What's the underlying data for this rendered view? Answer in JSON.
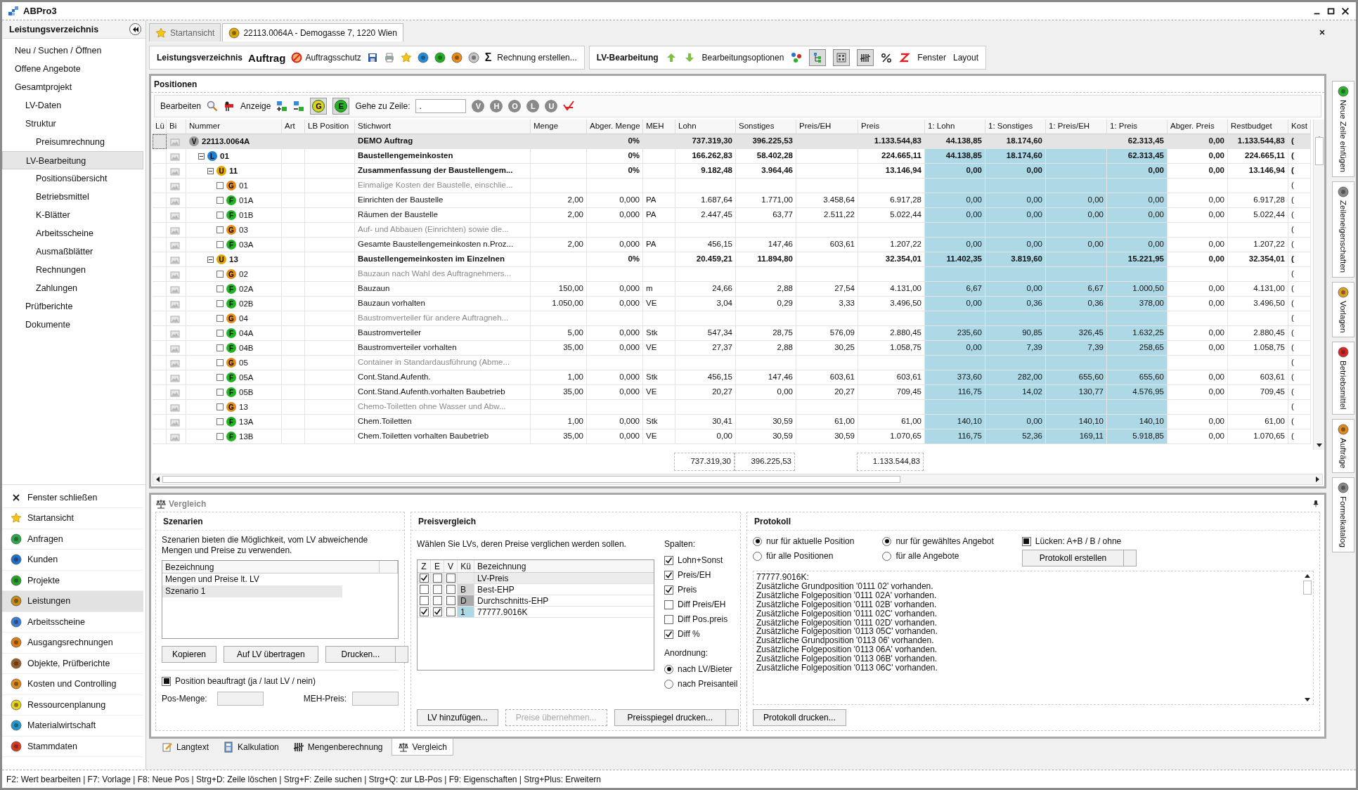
{
  "window": {
    "title": "ABPro3"
  },
  "sidebar": {
    "title": "Leistungsverzeichnis",
    "tree": [
      {
        "label": "Neu / Suchen / Öffnen",
        "selected": false
      },
      {
        "label": "Offene Angebote",
        "selected": false
      },
      {
        "label": "Gesamtprojekt",
        "selected": false,
        "children": [
          {
            "label": "LV-Daten",
            "selected": false
          },
          {
            "label": "Struktur",
            "selected": false,
            "children": [
              {
                "label": "Preisumrechnung",
                "selected": false
              }
            ]
          },
          {
            "label": "LV-Bearbeitung",
            "selected": true,
            "children": [
              {
                "label": "Positionsübersicht",
                "selected": false
              },
              {
                "label": "Betriebsmittel",
                "selected": false
              },
              {
                "label": "K-Blätter",
                "selected": false
              },
              {
                "label": "Arbeitsscheine",
                "selected": false
              },
              {
                "label": "Ausmaßblätter",
                "selected": false
              },
              {
                "label": "Rechnungen",
                "selected": false
              },
              {
                "label": "Zahlungen",
                "selected": false
              }
            ]
          },
          {
            "label": "Prüfberichte",
            "selected": false
          },
          {
            "label": "Dokumente",
            "selected": false
          }
        ]
      }
    ],
    "nav": [
      {
        "label": "Fenster schließen",
        "selected": false
      },
      {
        "label": "Startansicht",
        "selected": false
      },
      {
        "label": "Anfragen",
        "selected": false
      },
      {
        "label": "Kunden",
        "selected": false
      },
      {
        "label": "Projekte",
        "selected": false
      },
      {
        "label": "Leistungen",
        "selected": true
      },
      {
        "label": "Arbeitsscheine",
        "selected": false
      },
      {
        "label": "Ausgangsrechnungen",
        "selected": false
      },
      {
        "label": "Objekte, Prüfberichte",
        "selected": false
      },
      {
        "label": "Kosten und Controlling",
        "selected": false
      },
      {
        "label": "Ressourcenplanung",
        "selected": false
      },
      {
        "label": "Materialwirtschaft",
        "selected": false
      },
      {
        "label": "Stammdaten",
        "selected": false
      }
    ]
  },
  "tabs": [
    {
      "label": "Startansicht",
      "selected": false
    },
    {
      "label": "22113.0064A - Demogasse 7, 1220 Wien",
      "selected": true
    }
  ],
  "toolbar": {
    "lv_menu": "Leistungsverzeichnis",
    "auftrag_menu": "Auftrag",
    "protect_button": "Auftragsschutz",
    "sum_icon": "Σ",
    "invoice_button": "Rechnung erstellen...",
    "edit_menu": "LV-Bearbeitung",
    "options_menu": "Bearbeitungsoptionen",
    "toggles": [
      {
        "pressed": true
      },
      {
        "pressed": true
      },
      {
        "pressed": true
      }
    ],
    "window_menu": "Fenster",
    "layout_menu": "Layout"
  },
  "positions": {
    "title": "Positionen",
    "edit_menu": "Bearbeiten",
    "view_menu": "Anzeige",
    "filter_toggles": [
      {
        "label": "G",
        "pressed": true
      },
      {
        "label": "E",
        "pressed": true
      }
    ],
    "goto_label": "Gehe zu Zeile:",
    "goto_value": ".",
    "level_filters": [
      {
        "label": "V",
        "disabled": true
      },
      {
        "label": "H",
        "disabled": true
      },
      {
        "label": "O",
        "disabled": true
      },
      {
        "label": "L",
        "disabled": true
      },
      {
        "label": "U",
        "disabled": true
      }
    ]
  },
  "table": {
    "columns": [
      {
        "label": "Lü",
        "highlight": false
      },
      {
        "label": "Bi",
        "highlight": false
      },
      {
        "label": "Nummer",
        "highlight": false
      },
      {
        "label": "Art",
        "highlight": false
      },
      {
        "label": "LB Position",
        "highlight": false
      },
      {
        "label": "Stichwort",
        "highlight": false
      },
      {
        "label": "Menge",
        "highlight": false
      },
      {
        "label": "Abger. Menge",
        "highlight": false
      },
      {
        "label": "MEH",
        "highlight": false
      },
      {
        "label": "Lohn",
        "highlight": false
      },
      {
        "label": "Sonstiges",
        "highlight": false
      },
      {
        "label": "Preis/EH",
        "highlight": false
      },
      {
        "label": "Preis",
        "highlight": false
      },
      {
        "label": "1: Lohn",
        "highlight": true
      },
      {
        "label": "1: Sonstiges",
        "highlight": true
      },
      {
        "label": "1: Preis/EH",
        "highlight": true
      },
      {
        "label": "1: Preis",
        "highlight": true
      },
      {
        "label": "Abger. Preis",
        "highlight": false
      },
      {
        "label": "Restbudget",
        "highlight": false
      },
      {
        "label": "Kost",
        "highlight": false
      }
    ],
    "rows": [
      {
        "kind": "group",
        "badge": "V",
        "color": "#9a9a9a",
        "selected": true,
        "cells": [
          null,
          null,
          "22113.0064A",
          null,
          null,
          "DEMO Auftrag",
          null,
          "0%",
          null,
          "737.319,30",
          "396.225,53",
          null,
          "1.133.544,83",
          "44.138,85",
          "18.174,60",
          null,
          "62.313,45",
          "0,00",
          "1.133.544,83",
          "("
        ],
        "children": [
          {
            "kind": "group",
            "badge": "L",
            "color": "#1e7fd6",
            "selected": false,
            "expanded": true,
            "cells": [
              null,
              null,
              "01",
              null,
              null,
              "Baustellengemeinkosten",
              null,
              "0%",
              null,
              "166.262,83",
              "58.402,28",
              null,
              "224.665,11",
              "44.138,85",
              "18.174,60",
              null,
              "62.313,45",
              "0,00",
              "224.665,11",
              "("
            ],
            "children": [
              {
                "kind": "group",
                "badge": "U",
                "color": "#e2a400",
                "selected": false,
                "expanded": true,
                "cells": [
                  null,
                  null,
                  "11",
                  null,
                  null,
                  "Zusammenfassung der Baustellengem...",
                  null,
                  "0%",
                  null,
                  "9.182,48",
                  "3.964,46",
                  null,
                  "13.146,94",
                  "0,00",
                  "0,00",
                  null,
                  "0,00",
                  "0,00",
                  "13.146,94",
                  "("
                ],
                "children": [
                  {
                    "kind": "text",
                    "badge": "G",
                    "color": "#e58b1e",
                    "selected": false,
                    "checked": false,
                    "cells": [
                      null,
                      null,
                      "01",
                      null,
                      null,
                      "Einmalige Kosten der Baustelle, einschlie...",
                      null,
                      null,
                      null,
                      null,
                      null,
                      null,
                      null,
                      null,
                      null,
                      null,
                      null,
                      null,
                      null,
                      "("
                    ]
                  },
                  {
                    "kind": "item",
                    "badge": "F",
                    "color": "#22b322",
                    "selected": false,
                    "checked": false,
                    "cells": [
                      null,
                      null,
                      "01A",
                      null,
                      null,
                      "Einrichten der Baustelle",
                      "2,00",
                      "0,000",
                      "PA",
                      "1.687,64",
                      "1.771,00",
                      "3.458,64",
                      "6.917,28",
                      "0,00",
                      "0,00",
                      "0,00",
                      "0,00",
                      "0,00",
                      "6.917,28",
                      "("
                    ]
                  },
                  {
                    "kind": "item",
                    "badge": "F",
                    "color": "#22b322",
                    "selected": false,
                    "checked": false,
                    "cells": [
                      null,
                      null,
                      "01B",
                      null,
                      null,
                      "Räumen der Baustelle",
                      "2,00",
                      "0,000",
                      "PA",
                      "2.447,45",
                      "63,77",
                      "2.511,22",
                      "5.022,44",
                      "0,00",
                      "0,00",
                      "0,00",
                      "0,00",
                      "0,00",
                      "5.022,44",
                      "("
                    ]
                  },
                  {
                    "kind": "text",
                    "badge": "G",
                    "color": "#e58b1e",
                    "selected": false,
                    "checked": false,
                    "cells": [
                      null,
                      null,
                      "03",
                      null,
                      null,
                      "Auf- und Abbauen (Einrichten) sowie die...",
                      null,
                      null,
                      null,
                      null,
                      null,
                      null,
                      null,
                      null,
                      null,
                      null,
                      null,
                      null,
                      null,
                      "("
                    ]
                  },
                  {
                    "kind": "item",
                    "badge": "F",
                    "color": "#22b322",
                    "selected": false,
                    "checked": false,
                    "cells": [
                      null,
                      null,
                      "03A",
                      null,
                      null,
                      "Gesamte Baustellengemeinkosten n.Proz...",
                      "2,00",
                      "0,000",
                      "PA",
                      "456,15",
                      "147,46",
                      "603,61",
                      "1.207,22",
                      "0,00",
                      "0,00",
                      "0,00",
                      "0,00",
                      "0,00",
                      "1.207,22",
                      "("
                    ]
                  }
                ]
              },
              {
                "kind": "group",
                "badge": "U",
                "color": "#e2a400",
                "selected": false,
                "expanded": true,
                "cells": [
                  null,
                  null,
                  "13",
                  null,
                  null,
                  "Baustellengemeinkosten im Einzelnen",
                  null,
                  "0%",
                  null,
                  "20.459,21",
                  "11.894,80",
                  null,
                  "32.354,01",
                  "11.402,35",
                  "3.819,60",
                  null,
                  "15.221,95",
                  "0,00",
                  "32.354,01",
                  "("
                ],
                "children": [
                  {
                    "kind": "text",
                    "badge": "G",
                    "color": "#e58b1e",
                    "selected": false,
                    "checked": false,
                    "cells": [
                      null,
                      null,
                      "02",
                      null,
                      null,
                      "Bauzaun nach Wahl des Auftragnehmers...",
                      null,
                      null,
                      null,
                      null,
                      null,
                      null,
                      null,
                      null,
                      null,
                      null,
                      null,
                      null,
                      null,
                      "("
                    ]
                  },
                  {
                    "kind": "item",
                    "badge": "F",
                    "color": "#22b322",
                    "selected": false,
                    "checked": false,
                    "cells": [
                      null,
                      null,
                      "02A",
                      null,
                      null,
                      "Bauzaun",
                      "150,00",
                      "0,000",
                      "m",
                      "24,66",
                      "2,88",
                      "27,54",
                      "4.131,00",
                      "6,67",
                      "0,00",
                      "6,67",
                      "1.000,50",
                      "0,00",
                      "4.131,00",
                      "("
                    ]
                  },
                  {
                    "kind": "item",
                    "badge": "F",
                    "color": "#22b322",
                    "selected": false,
                    "checked": false,
                    "cells": [
                      null,
                      null,
                      "02B",
                      null,
                      null,
                      "Bauzaun vorhalten",
                      "1.050,00",
                      "0,000",
                      "VE",
                      "3,04",
                      "0,29",
                      "3,33",
                      "3.496,50",
                      "0,00",
                      "0,36",
                      "0,36",
                      "378,00",
                      "0,00",
                      "3.496,50",
                      "("
                    ]
                  },
                  {
                    "kind": "text",
                    "badge": "G",
                    "color": "#e58b1e",
                    "selected": false,
                    "checked": false,
                    "cells": [
                      null,
                      null,
                      "04",
                      null,
                      null,
                      "Baustromverteiler für andere Auftragneh...",
                      null,
                      null,
                      null,
                      null,
                      null,
                      null,
                      null,
                      null,
                      null,
                      null,
                      null,
                      null,
                      null,
                      "("
                    ]
                  },
                  {
                    "kind": "item",
                    "badge": "F",
                    "color": "#22b322",
                    "selected": false,
                    "checked": false,
                    "cells": [
                      null,
                      null,
                      "04A",
                      null,
                      null,
                      "Baustromverteiler",
                      "5,00",
                      "0,000",
                      "Stk",
                      "547,34",
                      "28,75",
                      "576,09",
                      "2.880,45",
                      "235,60",
                      "90,85",
                      "326,45",
                      "1.632,25",
                      "0,00",
                      "2.880,45",
                      "("
                    ]
                  },
                  {
                    "kind": "item",
                    "badge": "F",
                    "color": "#22b322",
                    "selected": false,
                    "checked": false,
                    "cells": [
                      null,
                      null,
                      "04B",
                      null,
                      null,
                      "Baustromverteiler vorhalten",
                      "35,00",
                      "0,000",
                      "VE",
                      "27,37",
                      "2,88",
                      "30,25",
                      "1.058,75",
                      "0,00",
                      "7,39",
                      "7,39",
                      "258,65",
                      "0,00",
                      "1.058,75",
                      "("
                    ]
                  },
                  {
                    "kind": "text",
                    "badge": "G",
                    "color": "#e58b1e",
                    "selected": false,
                    "checked": false,
                    "cells": [
                      null,
                      null,
                      "05",
                      null,
                      null,
                      "Container in Standardausführung (Abme...",
                      null,
                      null,
                      null,
                      null,
                      null,
                      null,
                      null,
                      null,
                      null,
                      null,
                      null,
                      null,
                      null,
                      "("
                    ]
                  },
                  {
                    "kind": "item",
                    "badge": "F",
                    "color": "#22b322",
                    "selected": false,
                    "checked": false,
                    "cells": [
                      null,
                      null,
                      "05A",
                      null,
                      null,
                      "Cont.Stand.Aufenth.",
                      "1,00",
                      "0,000",
                      "Stk",
                      "456,15",
                      "147,46",
                      "603,61",
                      "603,61",
                      "373,60",
                      "282,00",
                      "655,60",
                      "655,60",
                      "0,00",
                      "603,61",
                      "("
                    ]
                  },
                  {
                    "kind": "item",
                    "badge": "F",
                    "color": "#22b322",
                    "selected": false,
                    "checked": false,
                    "cells": [
                      null,
                      null,
                      "05B",
                      null,
                      null,
                      "Cont.Stand.Aufenth.vorhalten Baubetrieb",
                      "35,00",
                      "0,000",
                      "VE",
                      "20,27",
                      "0,00",
                      "20,27",
                      "709,45",
                      "116,75",
                      "14,02",
                      "130,77",
                      "4.576,95",
                      "0,00",
                      "709,45",
                      "("
                    ]
                  },
                  {
                    "kind": "text",
                    "badge": "G",
                    "color": "#e58b1e",
                    "selected": false,
                    "checked": false,
                    "cells": [
                      null,
                      null,
                      "13",
                      null,
                      null,
                      "Chemo-Toiletten ohne Wasser und Abw...",
                      null,
                      null,
                      null,
                      null,
                      null,
                      null,
                      null,
                      null,
                      null,
                      null,
                      null,
                      null,
                      null,
                      "("
                    ]
                  },
                  {
                    "kind": "item",
                    "badge": "F",
                    "color": "#22b322",
                    "selected": false,
                    "checked": false,
                    "cells": [
                      null,
                      null,
                      "13A",
                      null,
                      null,
                      "Chem.Toiletten",
                      "1,00",
                      "0,000",
                      "Stk",
                      "30,41",
                      "30,59",
                      "61,00",
                      "61,00",
                      "140,10",
                      "0,00",
                      "140,10",
                      "140,10",
                      "0,00",
                      "61,00",
                      "("
                    ]
                  },
                  {
                    "kind": "item",
                    "badge": "F",
                    "color": "#22b322",
                    "selected": false,
                    "checked": false,
                    "cells": [
                      null,
                      null,
                      "13B",
                      null,
                      null,
                      "Chem.Toiletten vorhalten Baubetrieb",
                      "35,00",
                      "0,000",
                      "VE",
                      "0,00",
                      "30,59",
                      "30,59",
                      "1.070,65",
                      "116,75",
                      "52,36",
                      "169,11",
                      "5.918,85",
                      "0,00",
                      "1.070,65",
                      "("
                    ]
                  }
                ]
              }
            ]
          }
        ]
      }
    ],
    "totals": {
      "lohn": "737.319,30",
      "sonstiges": "396.225,53",
      "preis": "1.133.544,83"
    }
  },
  "side_tabs": [
    "Neue Zeile einfügen",
    "Zeileneigenschaften",
    "Vorlagen",
    "Betriebsmittel",
    "Aufträge",
    "Formelkatalog"
  ],
  "compare": {
    "title": "Vergleich",
    "scenarios": {
      "title": "Szenarien",
      "description": "Szenarien bieten die Möglichkeit, vom LV abweichende Mengen und Preise zu verwenden.",
      "column": "Bezeichnung",
      "rows": [
        {
          "label": "Mengen und Preise lt. LV",
          "selected": false
        },
        {
          "label": "Szenario 1",
          "selected": true
        }
      ],
      "buttons": [
        "Kopieren",
        "Auf LV übertragen",
        "Drucken..."
      ],
      "assigned": {
        "label": "Position beauftragt (ja / laut LV / nein)",
        "indeterminate": true
      },
      "qty_label": "Pos-Menge:",
      "price_label": "MEH-Preis:"
    },
    "prices": {
      "title": "Preisvergleich",
      "description": "Wählen Sie LVs, deren Preise verglichen werden sollen.",
      "columns": [
        "Z",
        "E",
        "V",
        "Kü",
        "Bezeichnung"
      ],
      "rows": [
        {
          "z": true,
          "e": false,
          "v": false,
          "label": "LV-Preis",
          "selected": true
        },
        {
          "z": false,
          "e": false,
          "v": false,
          "code": "B",
          "color": "#d4d4d4",
          "label": "Best-EHP",
          "selected": false
        },
        {
          "z": false,
          "e": false,
          "v": false,
          "code": "D",
          "color": "#a9a9a9",
          "label": "Durchschnitts-EHP",
          "selected": false
        },
        {
          "z": true,
          "e": true,
          "v": false,
          "code": "1",
          "color": "#add8e6",
          "label": "77777.9016K",
          "selected": false
        }
      ],
      "columns_title": "Spalten:",
      "column_options": [
        {
          "label": "Lohn+Sonst",
          "checked": true
        },
        {
          "label": "Preis/EH",
          "checked": true
        },
        {
          "label": "Preis",
          "checked": true
        },
        {
          "label": "Diff Preis/EH",
          "checked": false
        },
        {
          "label": "Diff Pos.preis",
          "checked": false
        },
        {
          "label": "Diff %",
          "checked": true
        }
      ],
      "order_title": "Anordnung:",
      "order_options": [
        {
          "label": "nach LV/Bieter",
          "selected": true
        },
        {
          "label": "nach Preisanteil",
          "selected": false
        }
      ],
      "buttons": [
        {
          "label": "LV hinzufügen...",
          "disabled": false
        },
        {
          "label": "Preise übernehmen...",
          "disabled": true
        },
        {
          "label": "Preisspiegel drucken...",
          "disabled": false
        }
      ]
    },
    "log": {
      "title": "Protokoll",
      "scope": [
        {
          "label": "nur für aktuelle Position",
          "selected": true
        },
        {
          "label": "für alle Positionen",
          "selected": false
        }
      ],
      "offers": [
        {
          "label": "nur für gewähltes Angebot",
          "selected": true
        },
        {
          "label": "für alle Angebote",
          "selected": false
        }
      ],
      "gaps": {
        "label": "Lücken: A+B / B / ohne",
        "indeterminate": true
      },
      "create_button": "Protokoll erstellen",
      "lines": [
        "77777.9016K:",
        "Zusätzliche Grundposition '0111 02' vorhanden.",
        "Zusätzliche Folgeposition '0111 02A' vorhanden.",
        "Zusätzliche Folgeposition '0111 02B' vorhanden.",
        "Zusätzliche Folgeposition '0111 02C' vorhanden.",
        "Zusätzliche Folgeposition '0111 02D' vorhanden.",
        "Zusätzliche Folgeposition '0113 05C' vorhanden.",
        "Zusätzliche Grundposition '0113 06' vorhanden.",
        "Zusätzliche Folgeposition '0113 06A' vorhanden.",
        "Zusätzliche Folgeposition '0113 06B' vorhanden.",
        "Zusätzliche Folgeposition '0113 06C' vorhanden."
      ],
      "print_button": "Protokoll drucken..."
    }
  },
  "bottom_tabs": [
    {
      "label": "Langtext",
      "selected": false
    },
    {
      "label": "Kalkulation",
      "selected": false
    },
    {
      "label": "Mengenberechnung",
      "selected": false
    },
    {
      "label": "Vergleich",
      "selected": true
    }
  ],
  "status_bar": "F2: Wert bearbeiten | F7: Vorlage | F8: Neue Pos | Strg+D: Zeile löschen | Strg+F: Zeile suchen | Strg+Q: zur LB-Pos | F9: Eigenschaften | Strg+Plus: Erweitern"
}
